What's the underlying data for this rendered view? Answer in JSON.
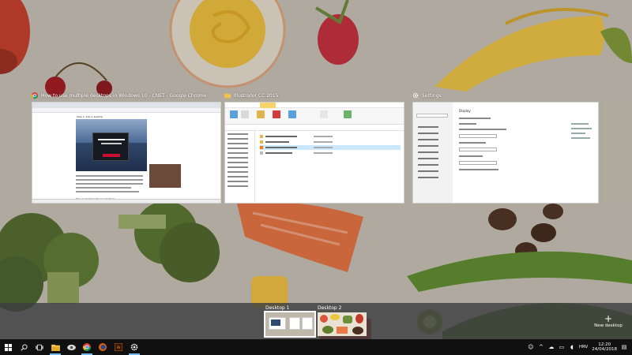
{
  "windows": [
    {
      "title": "How to use multiple desktops in Windows 10 - CNET - Google Chrome",
      "icon": "chrome-icon",
      "page_heading": "Step 1: Add a desktop",
      "page_subheading": "Step 2: Switch between desktops"
    },
    {
      "title": "Illustrator CC 2015",
      "icon": "folder-icon",
      "ribbon_tab": "Application Tools"
    },
    {
      "title": "Settings",
      "icon": "gear-icon",
      "page_heading": "Display"
    }
  ],
  "desktops": [
    {
      "label": "Desktop 1",
      "active": true
    },
    {
      "label": "Desktop 2",
      "active": false
    }
  ],
  "new_desktop_label": "New desktop",
  "taskbar": {
    "apps": [
      "start-icon",
      "search-icon",
      "task-view-icon",
      "file-explorer-icon",
      "mail-icon",
      "chrome-icon",
      "firefox-icon",
      "illustrator-icon",
      "settings-icon"
    ],
    "language": "HRV",
    "time": "12:20",
    "date": "24/04/2018"
  },
  "colors": {
    "accent": "#76b9ed",
    "taskbar": "#101010",
    "illustrator": "#ff7c00"
  }
}
